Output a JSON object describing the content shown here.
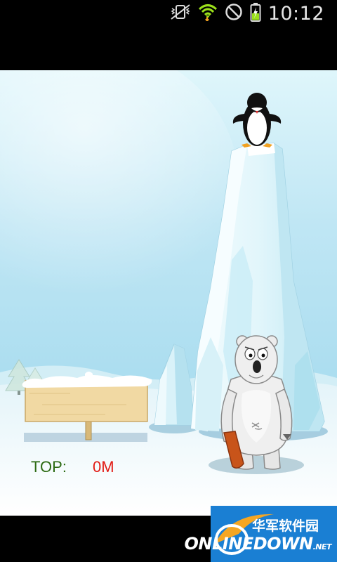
{
  "status_bar": {
    "time": "10:12",
    "icons": [
      "vibrate-icon",
      "wifi-icon",
      "no-signal-icon",
      "battery-charging-icon"
    ]
  },
  "game": {
    "scoreboard": {
      "top_label": "TOP:",
      "top_value": "0M"
    },
    "characters": [
      "penguin",
      "polar-bear"
    ],
    "bear_holds": "wooden-club"
  },
  "watermark": {
    "chinese": "华军软件园",
    "english": "ONLINEDOWN",
    "suffix": ".NET"
  },
  "colors": {
    "sky_top": "#c9edf6",
    "snow": "#f3fbfd",
    "ice": "#dff4fa",
    "top_label": "#2c6a12",
    "score_value": "#e21a14",
    "watermark_bg": "#1a7fd3"
  }
}
